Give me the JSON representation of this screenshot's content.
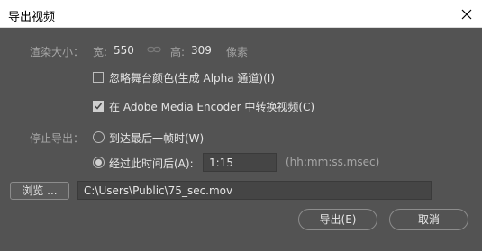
{
  "window": {
    "title": "导出视频"
  },
  "render_size": {
    "label": "渲染大小：",
    "width_label": "宽:",
    "width_value": "550",
    "height_label": "高:",
    "height_value": "309",
    "unit": "像素"
  },
  "options": {
    "ignore_stage_color": {
      "label": "忽略舞台颜色(生成 Alpha 通道)(I)",
      "checked": false
    },
    "convert_in_ame": {
      "label": "在 Adobe Media Encoder 中转换视频(C)",
      "checked": true
    }
  },
  "stop_export": {
    "label": "停止导出：",
    "reach_last_frame": {
      "label": "到达最后一帧时(W)",
      "selected": false
    },
    "after_time": {
      "label": "经过此时间后(A):",
      "selected": true,
      "value": "1:15",
      "format_hint": "(hh:mm:ss.msec)"
    }
  },
  "browse": {
    "button_label": "浏览 ...",
    "path": "C:\\Users\\Public\\75_sec.mov"
  },
  "buttons": {
    "export_label": "导出(E)",
    "cancel_label": "取消"
  }
}
